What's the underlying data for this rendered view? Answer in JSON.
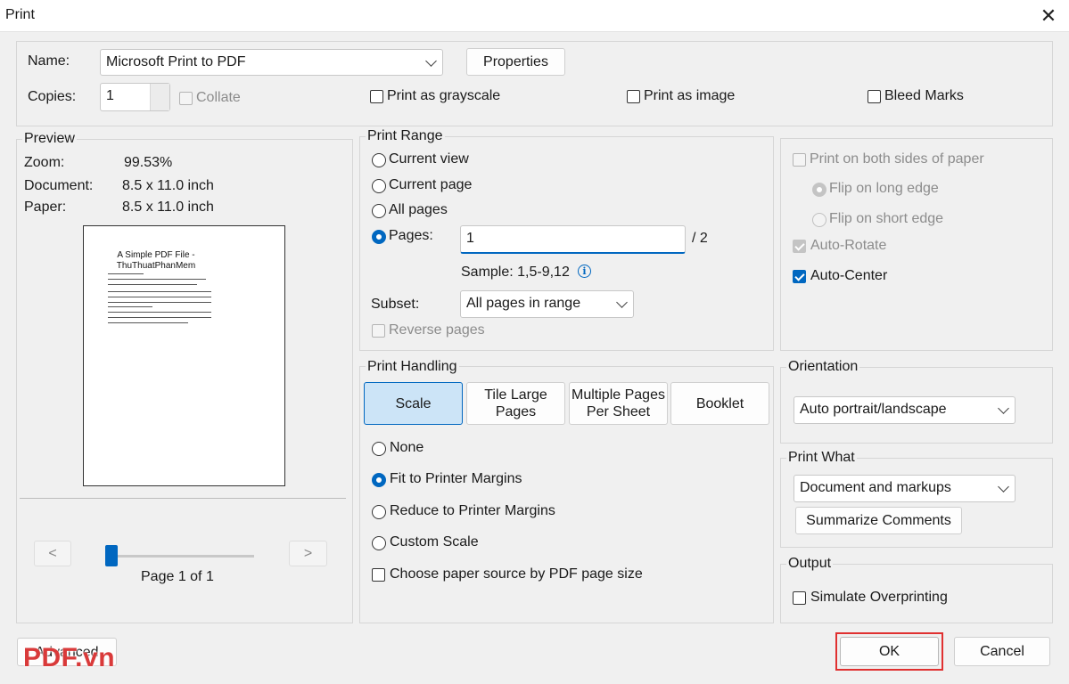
{
  "window": {
    "title": "Print",
    "close_glyph": "✕"
  },
  "printer": {
    "name_label": "Name:",
    "name_value": "Microsoft Print to PDF",
    "properties_label": "Properties",
    "copies_label": "Copies:",
    "copies_value": "1",
    "collate_label": "Collate",
    "grayscale_label": "Print as grayscale",
    "image_label": "Print as image",
    "bleed_label": "Bleed Marks"
  },
  "preview": {
    "legend": "Preview",
    "zoom_label": "Zoom:",
    "zoom_value": "99.53%",
    "document_label": "Document:",
    "document_value": "8.5 x 11.0 inch",
    "paper_label": "Paper:",
    "paper_value": "8.5 x 11.0 inch",
    "page_title": "A Simple PDF File - ThuThuatPhanMem",
    "prev_label": "<",
    "next_label": ">",
    "page_indicator": "Page 1 of 1",
    "slider_position": 0
  },
  "print_range": {
    "legend": "Print Range",
    "current_view": "Current view",
    "current_page": "Current page",
    "all_pages": "All pages",
    "pages_label": "Pages:",
    "pages_value": "1",
    "pages_total": "/ 2",
    "sample": "Sample: 1,5-9,12",
    "info_glyph": "i",
    "subset_label": "Subset:",
    "subset_value": "All pages in range",
    "reverse_label": "Reverse pages"
  },
  "duplex": {
    "both_sides": "Print on both sides of paper",
    "flip_long": "Flip on long edge",
    "flip_short": "Flip on short edge",
    "auto_rotate": "Auto-Rotate",
    "auto_center": "Auto-Center"
  },
  "handling": {
    "legend": "Print Handling",
    "tabs": {
      "scale": "Scale",
      "tile_line1": "Tile Large",
      "tile_line2": "Pages",
      "multi_line1": "Multiple Pages",
      "multi_line2": "Per Sheet",
      "booklet": "Booklet"
    },
    "none": "None",
    "fit": "Fit to Printer Margins",
    "reduce": "Reduce to Printer Margins",
    "custom": "Custom Scale",
    "paper_source": "Choose paper source by PDF page size"
  },
  "orientation": {
    "legend": "Orientation",
    "value": "Auto portrait/landscape"
  },
  "print_what": {
    "legend": "Print What",
    "value": "Document and markups",
    "summarize_label": "Summarize Comments"
  },
  "output": {
    "legend": "Output",
    "overprint_label": "Simulate Overprinting"
  },
  "footer": {
    "advanced_label": "Advanced",
    "ok_label": "OK",
    "cancel_label": "Cancel"
  },
  "watermark": {
    "text": "PDF.vn"
  },
  "colors": {
    "accent": "#0067c0",
    "ok_highlight": "#e03030",
    "watermark": "#d93a3a"
  }
}
